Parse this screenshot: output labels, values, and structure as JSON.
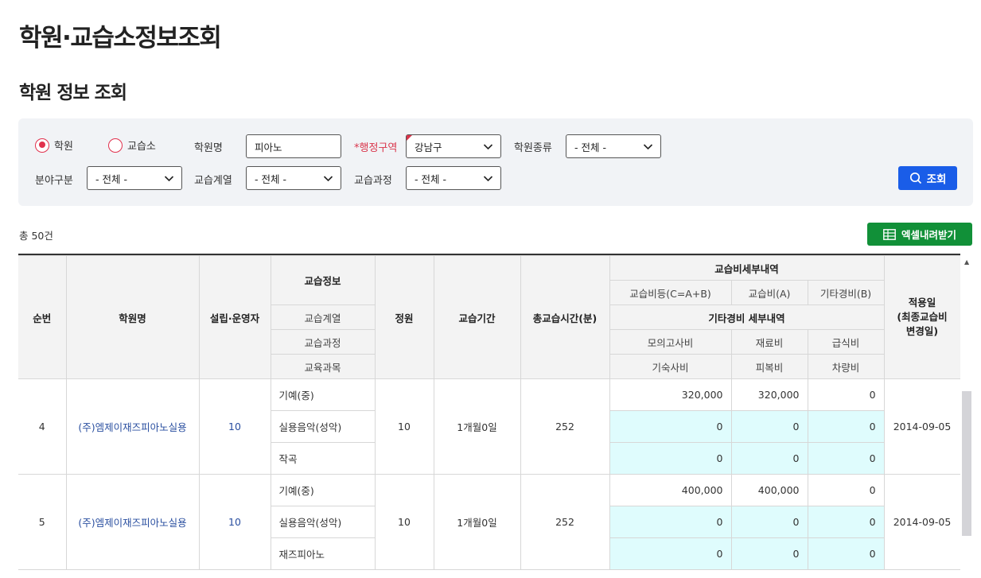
{
  "page_title": "학원·교습소정보조회",
  "section_title": "학원 정보 조회",
  "search": {
    "radio_academy": "학원",
    "radio_tutoring": "교습소",
    "academy_name_label": "학원명",
    "academy_name_value": "피아노",
    "district_label": "*행정구역",
    "district_value": "강남구",
    "academy_type_label": "학원종류",
    "academy_type_value": "- 전체 -",
    "field_label": "분야구분",
    "field_value": "- 전체 -",
    "series_label": "교습계열",
    "series_value": "- 전체 -",
    "course_label": "교습과정",
    "course_value": "- 전체 -",
    "search_button": "조회"
  },
  "total_text": "총 50건",
  "excel_button": "엑셀내려받기",
  "table": {
    "headers": {
      "seq": "순번",
      "name": "학원명",
      "founder": "설립·운영자",
      "lesson_info": "교습정보",
      "lesson_series": "교습계열",
      "lesson_course": "교습과정",
      "lesson_subject": "교육과목",
      "capacity": "정원",
      "period": "교습기간",
      "total_time": "총교습시간(분)",
      "fee_detail": "교습비세부내역",
      "fee_total": "교습비등(C=A+B)",
      "fee_a": "교습비(A)",
      "fee_b": "기타경비(B)",
      "other_detail": "기타경비 세부내역",
      "mock_exam": "모의고사비",
      "material": "재료비",
      "meal": "급식비",
      "dorm": "기숙사비",
      "uniform": "피복비",
      "vehicle": "차량비",
      "apply_date": "적용일\n(최종교습비\n변경일)"
    },
    "rows": [
      {
        "seq": "4",
        "name": "(주)엠제이재즈피아노실용",
        "founder": "10",
        "lines": [
          {
            "text": "기예(중)",
            "c": "320,000",
            "a": "320,000",
            "b": "0"
          },
          {
            "text": "실용음악(성악)",
            "c": "0",
            "a": "0",
            "b": "0"
          },
          {
            "text": "작곡",
            "c": "0",
            "a": "0",
            "b": "0"
          }
        ],
        "capacity": "10",
        "period": "1개월0일",
        "total_time": "252",
        "date": "2014-09-05"
      },
      {
        "seq": "5",
        "name": "(주)엠제이재즈피아노실용",
        "founder": "10",
        "lines": [
          {
            "text": "기예(중)",
            "c": "400,000",
            "a": "400,000",
            "b": "0"
          },
          {
            "text": "실용음악(성악)",
            "c": "0",
            "a": "0",
            "b": "0"
          },
          {
            "text": "재즈피아노",
            "c": "0",
            "a": "0",
            "b": "0"
          }
        ],
        "capacity": "10",
        "period": "1개월0일",
        "total_time": "252",
        "date": "2014-09-05"
      }
    ]
  },
  "colors": {
    "accent_red": "#e1314d",
    "search_blue": "#1a5de8",
    "excel_green": "#119038",
    "cyan_cell": "#dffcfd"
  }
}
